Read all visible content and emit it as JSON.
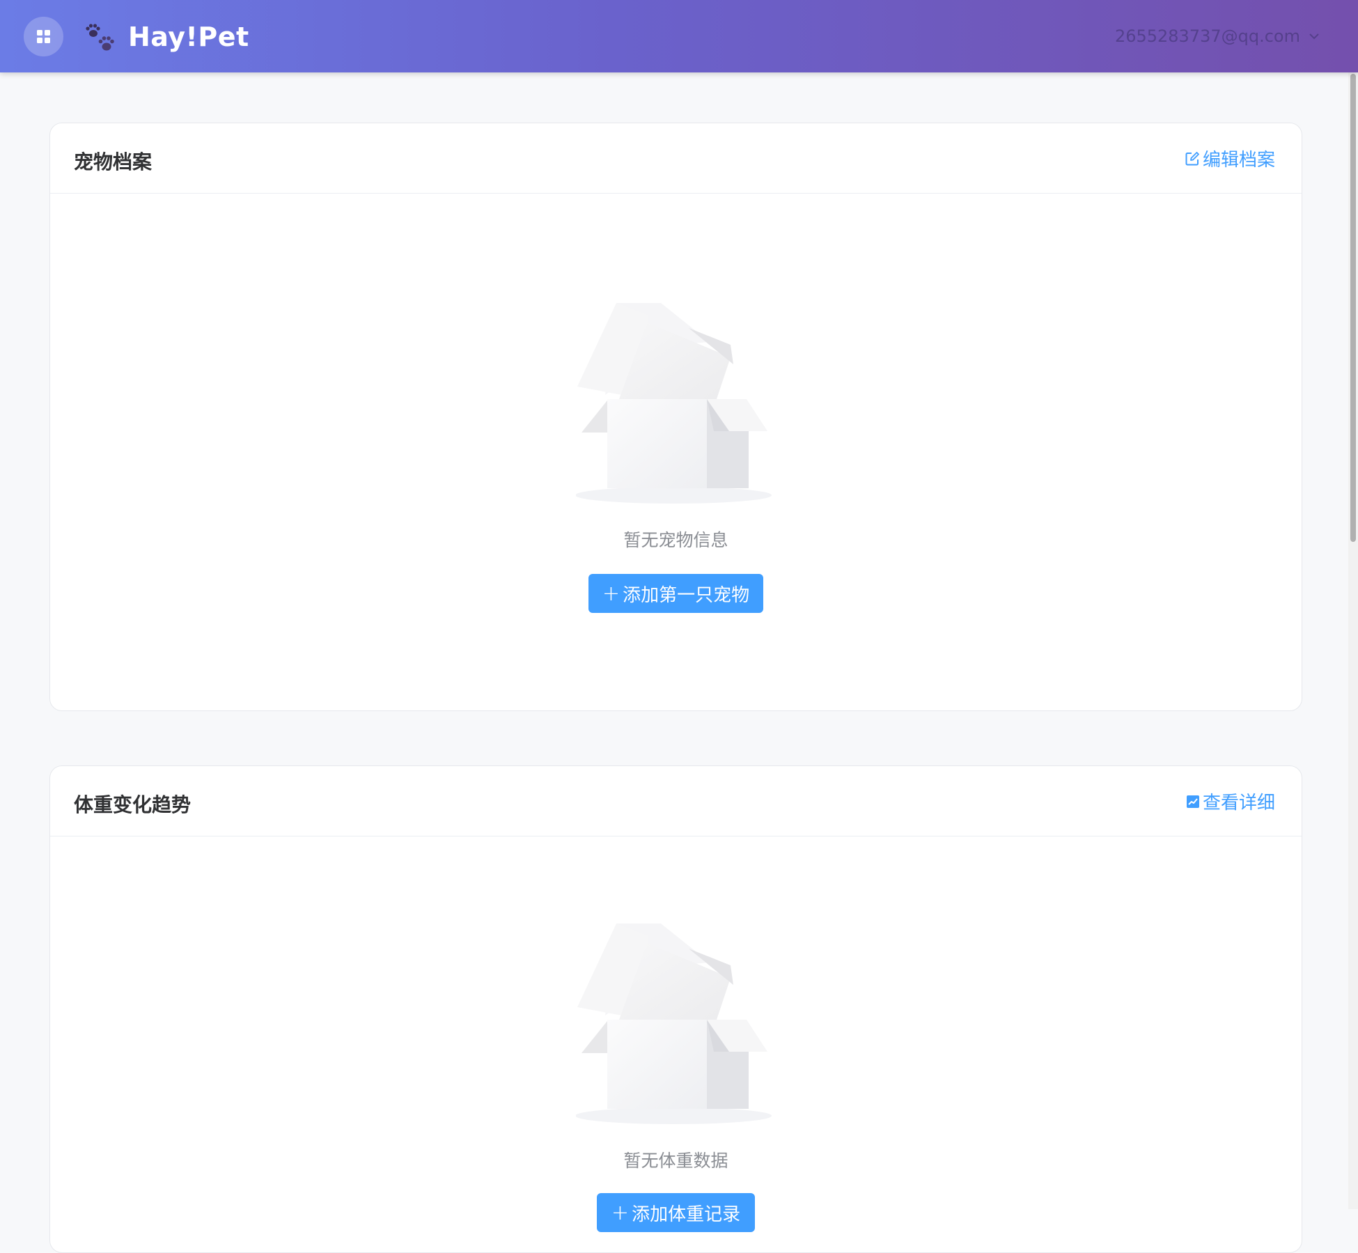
{
  "header": {
    "app_name": "Hay!Pet",
    "user_email": "2655283737@qq.com",
    "gradient_start": "#6b7ce6",
    "gradient_end": "#7450ad"
  },
  "pet_profile": {
    "title": "宠物档案",
    "action_label": "编辑档案",
    "empty_text": "暂无宠物信息",
    "add_button_label": "添加第一只宠物"
  },
  "weight_trend": {
    "title": "体重变化趋势",
    "action_label": "查看详细",
    "empty_text": "暂无体重数据",
    "add_button_label": "添加体重记录"
  },
  "colors": {
    "accent": "#409eff",
    "title": "#303133",
    "muted": "#8a8d93",
    "page_bg": "#f7f8fa"
  }
}
